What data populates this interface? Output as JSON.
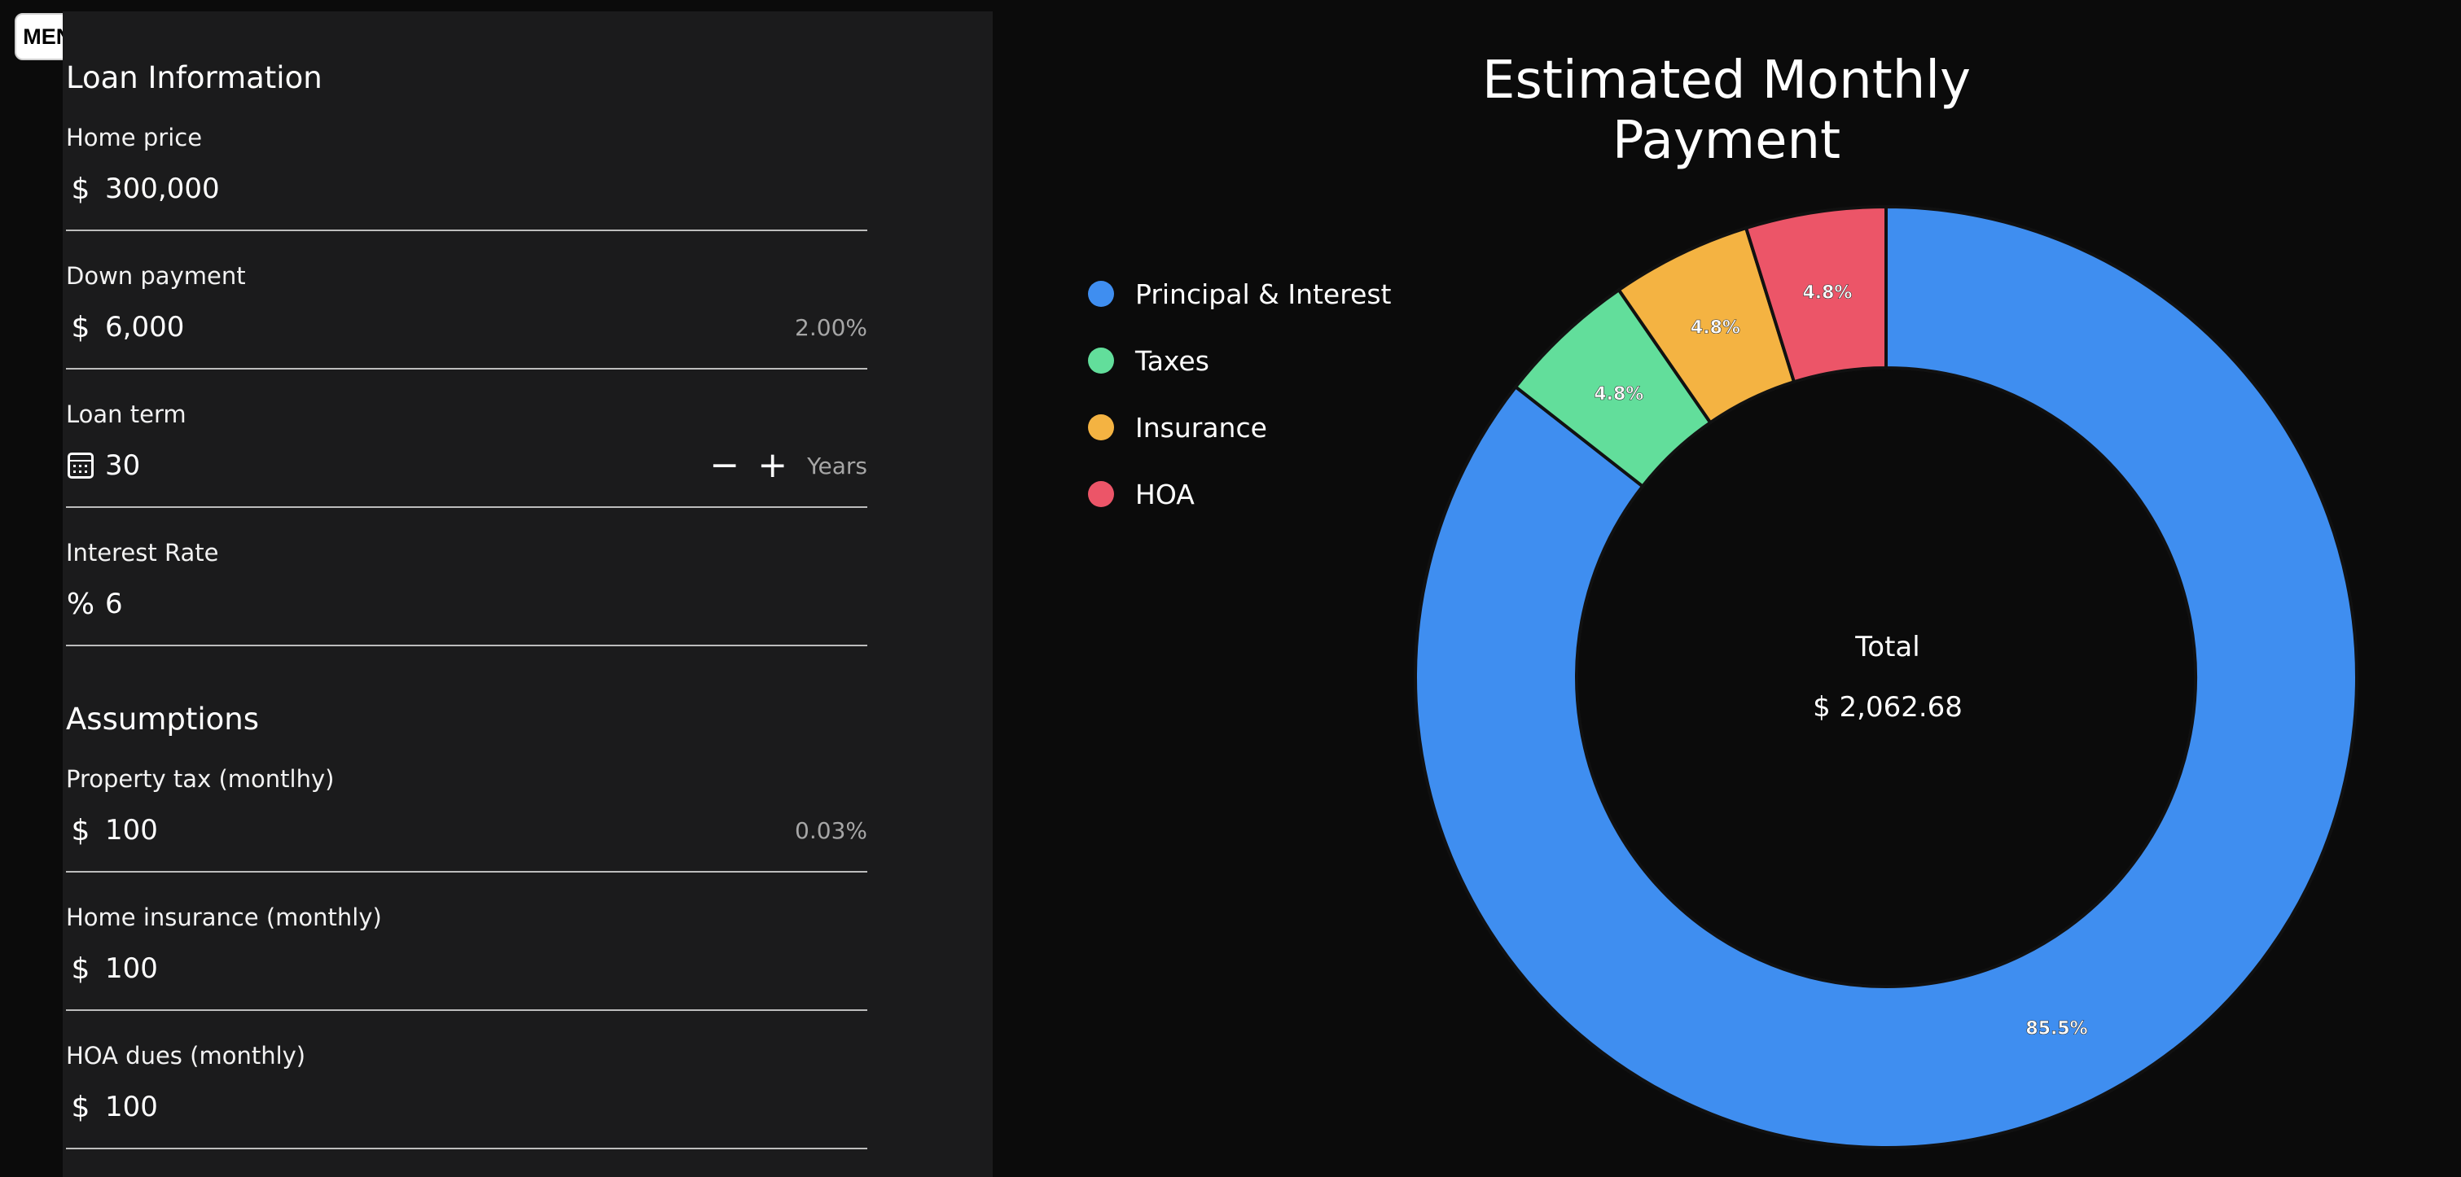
{
  "menu": {
    "label": "MENU"
  },
  "loan_section": {
    "title": "Loan Information"
  },
  "fields": {
    "home_price": {
      "label": "Home price",
      "icon": "dollar-icon",
      "value": "300,000"
    },
    "down_payment": {
      "label": "Down payment",
      "icon": "dollar-icon",
      "value": "6,000",
      "aux": "2.00%"
    },
    "loan_term": {
      "label": "Loan term",
      "icon": "calendar-icon",
      "value": "30",
      "decrement": "−",
      "increment": "+",
      "unit": "Years"
    },
    "interest_rate": {
      "label": "Interest Rate",
      "icon": "percent-icon",
      "value": "6"
    },
    "property_tax": {
      "label": "Property tax (montlhy)",
      "icon": "dollar-icon",
      "value": "100",
      "aux": "0.03%"
    },
    "home_insurance": {
      "label": "Home insurance (monthly)",
      "icon": "dollar-icon",
      "value": "100"
    },
    "hoa_dues": {
      "label": "HOA dues (monthly)",
      "icon": "dollar-icon",
      "value": "100"
    }
  },
  "assumptions_section": {
    "title": "Assumptions"
  },
  "chart": {
    "title": "Estimated Monthly Payment",
    "center_label": "Total",
    "center_value": "$ 2,062.68"
  },
  "chart_data": {
    "type": "pie",
    "title": "Estimated Monthly Payment",
    "categories": [
      "Principal & Interest",
      "Taxes",
      "Insurance",
      "HOA"
    ],
    "values": [
      85.5,
      4.8,
      4.8,
      4.8
    ],
    "value_labels": [
      "85.5%",
      "4.8%",
      "4.8%",
      "4.8%"
    ],
    "colors": [
      "#3f8ef0",
      "#62de9b",
      "#f4b342",
      "#ec5568"
    ],
    "legend": "left",
    "donut": true
  }
}
